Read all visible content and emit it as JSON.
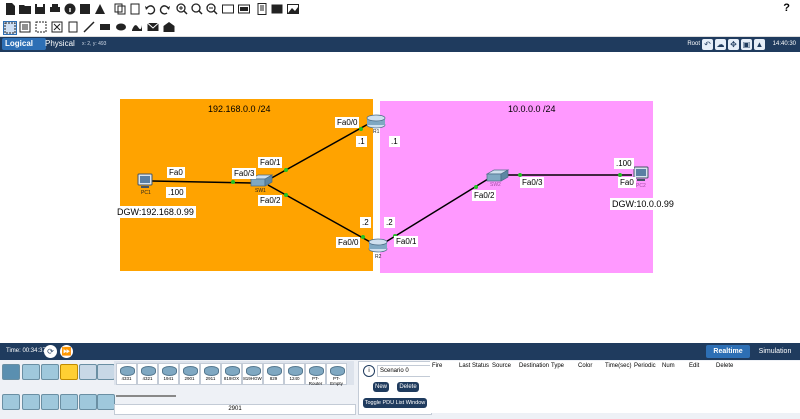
{
  "toolbar": {
    "help": "?"
  },
  "modebar": {
    "logical": "Logical",
    "physical": "Physical",
    "coords": "x: 2, y: 493",
    "root": "Root",
    "clock": "14:40:30"
  },
  "topology": {
    "left_network": "192.168.0.0 /24",
    "right_network": "10.0.0.0 /24",
    "colors": {
      "left_zone": "#ffa300",
      "right_zone": "#ff99ff",
      "link": "#000000",
      "port_up": "#22c322"
    },
    "devices": {
      "pc1": {
        "name": "PC1",
        "port": "Fa0",
        "ip": ".100",
        "dgw": "DGW:192.168.0.99"
      },
      "sw1": {
        "name": "SW1",
        "port_to_pc": "Fa0/3",
        "port_to_r1": "Fa0/1",
        "port_to_r2": "Fa0/2"
      },
      "r1": {
        "name": "R1",
        "port": "Fa0/0",
        "ip_left": ".1",
        "ip_right": ".1"
      },
      "r2": {
        "name": "R2",
        "port_left": "Fa0/0",
        "port_right": "Fa0/1",
        "ip_left": ".2",
        "ip_right": ".2"
      },
      "sw2": {
        "name": "SW2",
        "port_to_r2": "Fa0/2",
        "port_to_pc": "Fa0/3"
      },
      "pc2": {
        "name": "PC2",
        "port": "Fa0",
        "ip": ".100",
        "dgw": "DGW:10.0.0.99"
      }
    }
  },
  "status": {
    "time": "Time: 00:34:37",
    "realtime": "Realtime",
    "simulation": "Simulation"
  },
  "device_list": {
    "models": [
      "4331",
      "4321",
      "1941",
      "2901",
      "2911",
      "819IOX",
      "819HGW",
      "829",
      "1240",
      "PT-Router",
      "PT-Empty"
    ],
    "selected": "2901"
  },
  "scenario": {
    "select": "Scenario 0",
    "new": "New",
    "delete": "Delete",
    "toggle": "Toggle PDU List Window"
  },
  "pdu_columns": [
    "Fire",
    "Last Status",
    "Source",
    "Destination",
    "Type",
    "Color",
    "Time(sec)",
    "Periodic",
    "Num",
    "Edit",
    "Delete"
  ]
}
